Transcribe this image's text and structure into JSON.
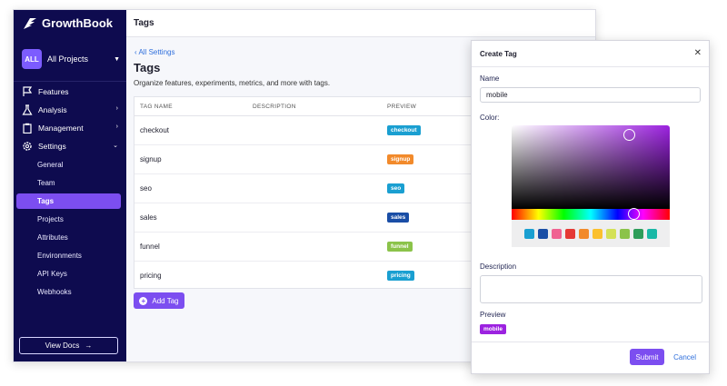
{
  "app": {
    "name": "GrowthBook"
  },
  "project": {
    "badge": "ALL",
    "name": "All Projects"
  },
  "nav": {
    "items": [
      {
        "label": "Features",
        "icon": "flag-icon",
        "arrow": ""
      },
      {
        "label": "Analysis",
        "icon": "flask-icon",
        "arrow": "›"
      },
      {
        "label": "Management",
        "icon": "clipboard-icon",
        "arrow": "›"
      },
      {
        "label": "Settings",
        "icon": "gear-icon",
        "arrow": "⌄"
      }
    ],
    "subitems": [
      "General",
      "Team",
      "Tags",
      "Projects",
      "Attributes",
      "Environments",
      "API Keys",
      "Webhooks"
    ],
    "active_sub": "Tags"
  },
  "view_docs": "View Docs",
  "topbar": {
    "title": "Tags"
  },
  "page": {
    "back": "All Settings",
    "title": "Tags",
    "description": "Organize features, experiments, metrics, and more with tags."
  },
  "table": {
    "headers": [
      "TAG NAME",
      "DESCRIPTION",
      "PREVIEW"
    ],
    "rows": [
      {
        "name": "checkout",
        "description": "",
        "preview": "checkout",
        "color": "#1a9fd1"
      },
      {
        "name": "signup",
        "description": "",
        "preview": "signup",
        "color": "#f28a2b"
      },
      {
        "name": "seo",
        "description": "",
        "preview": "seo",
        "color": "#1a9fd1"
      },
      {
        "name": "sales",
        "description": "",
        "preview": "sales",
        "color": "#1a4ea6"
      },
      {
        "name": "funnel",
        "description": "",
        "preview": "funnel",
        "color": "#8bc34a"
      },
      {
        "name": "pricing",
        "description": "",
        "preview": "pricing",
        "color": "#1a9fd1"
      }
    ]
  },
  "add_tag": "Add Tag",
  "modal": {
    "title": "Create Tag",
    "name_label": "Name",
    "name_value": "mobile",
    "color_label": "Color:",
    "selected_color": "#9c22e0",
    "swatches": [
      "#1a9fd1",
      "#1a4ea6",
      "#f06292",
      "#e53935",
      "#f28a2b",
      "#fbc02d",
      "#d4e157",
      "#8bc34a",
      "#2e9d5a",
      "#19b8a6"
    ],
    "description_label": "Description",
    "description_value": "",
    "preview_label": "Preview",
    "preview_tag": "mobile",
    "submit": "Submit",
    "cancel": "Cancel"
  }
}
